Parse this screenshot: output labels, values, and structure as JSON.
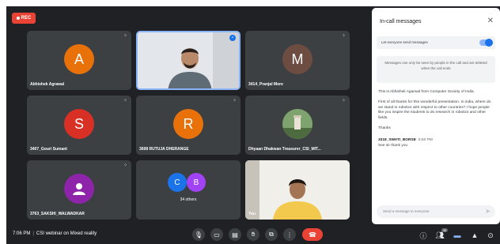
{
  "recording": {
    "label": "REC"
  },
  "participants": [
    {
      "name": "Abhishek Agrawal",
      "initial": "A",
      "color": "#e8710a"
    },
    {
      "name": "",
      "initial": "",
      "color": ""
    },
    {
      "name": "3414_Pranjal More",
      "initial": "M",
      "color": "#6d4c41"
    },
    {
      "name": "3407_Gouri Sumant",
      "initial": "S",
      "color": "#d93025"
    },
    {
      "name": "3698 RUTUJA DHERANGE",
      "initial": "R",
      "color": "#e8710a"
    },
    {
      "name": "Dhyaan Dhakwan Treasurer_CSI_MIT...",
      "initial": "",
      "color": ""
    },
    {
      "name": "3763_SAKSHI_WALWADKAR",
      "initial": "",
      "color": "#8e24aa"
    },
    {
      "name": "34 others",
      "initial_1": "C",
      "initial_2": "B",
      "color_1": "#1a73e8",
      "color_2": "#a142f4"
    },
    {
      "name": "You",
      "initial": "",
      "color": ""
    }
  ],
  "controls": {
    "time": "7:06 PM",
    "meeting_title": "CSI webinar on Mixed reality",
    "people_count": "38",
    "icons": [
      "mic-icon",
      "camera-icon",
      "captions-icon",
      "raise-hand-icon",
      "present-icon",
      "more-icon",
      "end-call-icon"
    ],
    "right_icons": [
      "info-icon",
      "people-icon",
      "chat-icon",
      "activities-icon",
      "lock-icon"
    ]
  },
  "chat_panel": {
    "title": "In-call messages",
    "toggle_label": "Let everyone send messages",
    "notice": "Messages can only be seen by people in the call and are deleted when the call ends",
    "messages": [
      "This is Abhishek Agarwal from Computer Society of India.",
      "First of all thanks for this wonderful presentation. In india, where do we stand in robotics with respect to other countries? I hope people like you inspire the students to do research in robotics and other fields.",
      "Thanks"
    ],
    "second_sender": "3318_SWATI_BORSE",
    "second_time": "6:50 PM",
    "second_message": "See sir thank you",
    "input_placeholder": "Send a message to everyone",
    "accent": "#1a73e8"
  }
}
